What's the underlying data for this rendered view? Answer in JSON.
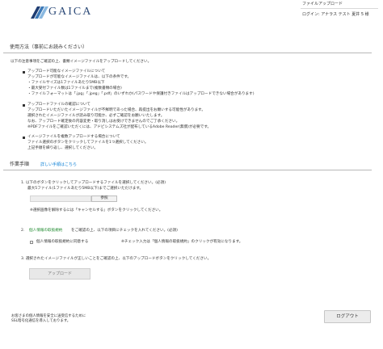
{
  "header": {
    "logo_text": "GAICA",
    "page_name": "ファイルアップロード",
    "login_info": "ログイン: アナラス テスト 夏井 5 様",
    "logo_colors": [
      "#1f3d73",
      "#3d7ab8",
      "#89b8e0"
    ]
  },
  "usage": {
    "title": "使用方法（事前にお読みください）",
    "intro": "以下の注意事項をご確認の上、書類イメージファイルをアップロードしてください。",
    "blocks": [
      {
        "heading": "アップロード可能なイメージファイルについて",
        "lines": [
          "アップロードが可能なイメージファイルは、以下の条件です。",
          "・ファイルサイズは1ファイルあたり5MB以下",
          "・最大受付ファイル数は1ファイルまで(複数書類の場合)",
          "・ファイルフォーマットは「.jpg」「.jpeg」「.pdf」のいずれか(パスワードや保護付きファイルはアップロードできない場合があります)"
        ]
      },
      {
        "heading": "アップロードファイルの確認について",
        "lines": [
          "アップロードいただいたイメージファイルが不鮮明であった場合、再提出をお願いする可能性があります。",
          "選択されたイメージファイルが読み取り可能か、必ずご確認をお願いいたします。",
          "なお、アップロード確定後の内容変更・取り消しはお受けできませんのでご了承ください。",
          "※PDFファイルをご確認いただくには、アドビシステムズ社が配布しているAdobe Reader(無償)が必要です。"
        ]
      },
      {
        "heading": "イメージファイルを複数アップロードする場合について",
        "lines": [
          "ファイル選択のボタンをクリックしてファイルを1つ選択してください。",
          "上記手順を繰り返し、選択してください。"
        ]
      }
    ]
  },
  "steps": {
    "title": "作業手順",
    "link": "詳しい手順はこちら",
    "step1_a": "1. 以下のボタンをクリックしてアップロードするファイルを選択してください。(必須)",
    "step1_b": "最大5ファイル(1ファイルあたり5MB以下)までご選択いただけます。",
    "browse_label": "参照",
    "step1_note": "※選択画像を解除するには「キャンセルする」ボタンをクリックしてください。",
    "step2_num": "2.",
    "step2_link": "個人情報の取扱規約",
    "step2_text": "をご確認の上、以下の項目にチェックを入れてください。(必須)",
    "agree_label": "個人情報の取扱規約に同意する",
    "agree_note": "※チェック入力は「個人情報の取扱規約」のクリックが有効になります。",
    "step3": "3. 選択されたイメージファイルが正しいことをご確認の上、以下のアップロードボタンをクリックしてください。",
    "upload_label": "アップロード"
  },
  "footer": {
    "line1": "お客さまの個人情報を安全に送受信するために",
    "line2": "SSL暗号化通信を導入しております。",
    "logout_label": "ログアウト"
  }
}
